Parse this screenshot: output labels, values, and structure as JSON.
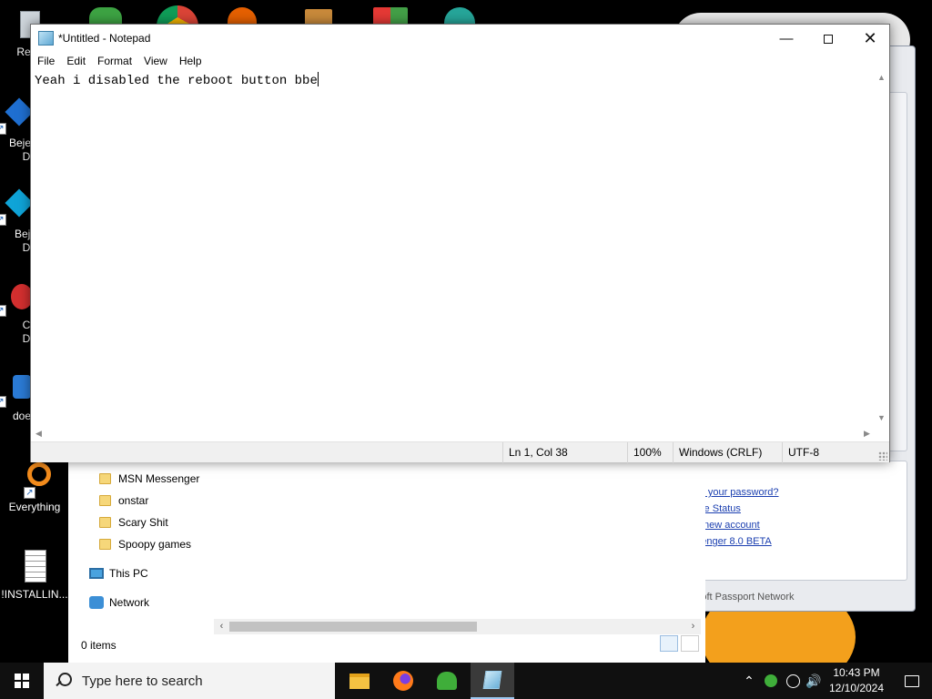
{
  "desktop": {
    "icons": [
      {
        "label": "Recy",
        "icon": "recycle-bin-icon"
      },
      {
        "label": "Bejev\nDe",
        "icon": "bejeweled-icon"
      },
      {
        "label": "Beje\nDe",
        "icon": "bejeweled-icon"
      },
      {
        "label": "Ch\nDe",
        "icon": "chrome-icon"
      },
      {
        "label": "does",
        "icon": "app-icon"
      },
      {
        "label": "Everything",
        "icon": "everything-search-icon"
      },
      {
        "label": "!INSTALLIN...",
        "icon": "text-document-icon"
      }
    ]
  },
  "explorer": {
    "nav_items": [
      "MSN Messenger",
      "onstar",
      "Scary Shit",
      "Spoopy games"
    ],
    "this_pc": "This PC",
    "network": "Network",
    "status": "0 items"
  },
  "messenger": {
    "links": [
      "Forgot your password?",
      "Service Status",
      "Get a new account",
      "Messenger 8.0 BETA"
    ],
    "footer": "Microsoft Passport Network"
  },
  "notepad": {
    "title": "*Untitled - Notepad",
    "menu": [
      "File",
      "Edit",
      "Format",
      "View",
      "Help"
    ],
    "content": "Yeah i disabled the reboot button bbe",
    "status": {
      "position": "Ln 1, Col 38",
      "zoom": "100%",
      "line_ending": "Windows (CRLF)",
      "encoding": "UTF-8"
    }
  },
  "taskbar": {
    "search_placeholder": "Type here to search",
    "pinned": [
      "file-explorer-icon",
      "firefox-icon",
      "msn-messenger-icon",
      "notepad-icon"
    ],
    "clock": {
      "time": "10:43 PM",
      "date": "12/10/2024"
    }
  }
}
